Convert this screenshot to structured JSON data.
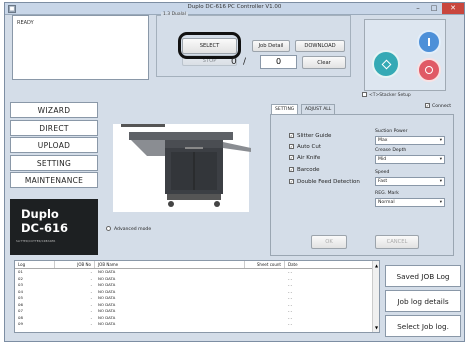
{
  "window": {
    "title": "Duplo DC-616 PC Controller V1.00",
    "minimize": "–",
    "maximize": "□",
    "close": "✕",
    "app_icon": "window-icon"
  },
  "status": {
    "text": "READY"
  },
  "job_group": {
    "legend": "1.3 Dualal"
  },
  "job_buttons": {
    "select": "SELECT",
    "job_detail": "Job Detail",
    "download": "DOWNLOAD",
    "stop": "STOP"
  },
  "counter": {
    "current": "0",
    "separator": "/",
    "total": "0",
    "clear": "Clear"
  },
  "deco": {
    "icons": [
      "left-circle-icon",
      "top-circle-icon",
      "right-circle-icon"
    ],
    "colors": [
      "#35aab5",
      "#4d90d8",
      "#e05a66"
    ]
  },
  "stacker_setup": {
    "label": "<T>Stacker Setup"
  },
  "nav": {
    "items": [
      "WIZARD",
      "DIRECT",
      "UPLOAD",
      "SETTING",
      "MAINTENANCE"
    ]
  },
  "logo": {
    "line1": "Duplo",
    "line2": "DC-616",
    "tagline": "SLITTER/CUTTER/CREASER"
  },
  "advanced_mode": {
    "label": "Advanced mode"
  },
  "tabs": {
    "setting": "SETTING",
    "adjust_all": "ADJUST ALL"
  },
  "connect": {
    "label": "Connect"
  },
  "options": {
    "slitter_guide": "Slitter Guide",
    "auto_cut": "Auto Cut",
    "air_knife": "Air Knife",
    "barcode": "Barcode",
    "double_feed": "Double Feed Detection"
  },
  "dropdowns": {
    "suction_power": {
      "label": "Suction Power",
      "value": "Max"
    },
    "crease_depth": {
      "label": "Crease Depth",
      "value": "Mid"
    },
    "speed": {
      "label": "Speed",
      "value": "Fast"
    },
    "reg_mark": {
      "label": "REG. Mark",
      "value": "Normal"
    }
  },
  "dialog_buttons": {
    "ok": "OK",
    "cancel": "CANCEL"
  },
  "log": {
    "headers": [
      "Log",
      "JOB No",
      "JOB Name",
      "Sheet count",
      "Date"
    ],
    "rows": [
      {
        "log": "01",
        "job": "-",
        "name": "NO DATA",
        "count": "",
        "date": "- -"
      },
      {
        "log": "02",
        "job": "-",
        "name": "NO DATA",
        "count": "",
        "date": "- -"
      },
      {
        "log": "03",
        "job": "-",
        "name": "NO DATA",
        "count": "",
        "date": "- -"
      },
      {
        "log": "04",
        "job": "-",
        "name": "NO DATA",
        "count": "",
        "date": "- -"
      },
      {
        "log": "05",
        "job": "-",
        "name": "NO DATA",
        "count": "",
        "date": "- -"
      },
      {
        "log": "06",
        "job": "-",
        "name": "NO DATA",
        "count": "",
        "date": "- -"
      },
      {
        "log": "07",
        "job": "-",
        "name": "NO DATA",
        "count": "",
        "date": "- -"
      },
      {
        "log": "08",
        "job": "-",
        "name": "NO DATA",
        "count": "",
        "date": "- -"
      },
      {
        "log": "09",
        "job": "-",
        "name": "NO DATA",
        "count": "",
        "date": "- -"
      }
    ]
  },
  "right_buttons": {
    "saved_log": "Saved JOB Log",
    "log_details": "Job log details",
    "select_log": "Select Job log."
  }
}
